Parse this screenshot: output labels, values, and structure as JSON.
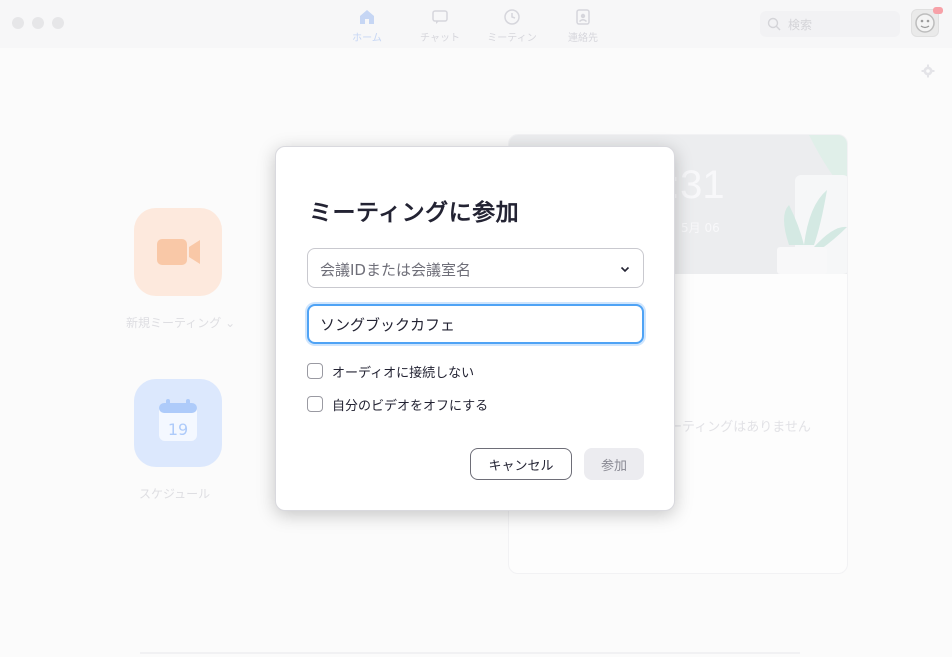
{
  "nav": {
    "home": "ホーム",
    "chat": "チャット",
    "meetings": "ミーティン",
    "contacts": "連絡先"
  },
  "search": {
    "placeholder": "検索"
  },
  "home": {
    "new_meeting_label": "新規ミーティング ⌄",
    "schedule_label": "スケジュール",
    "calendar_day": "19"
  },
  "card": {
    "clock": ":31",
    "date": "5月 06",
    "no_meetings": "ーティングはありません"
  },
  "dialog": {
    "title": "ミーティングに参加",
    "meeting_id_placeholder": "会議IDまたは会議室名",
    "name_value": "ソングブックカフェ",
    "options": [
      {
        "label": "オーディオに接続しない",
        "checked": false
      },
      {
        "label": "自分のビデオをオフにする",
        "checked": false
      }
    ],
    "cancel_label": "キャンセル",
    "join_label": "参加"
  },
  "colors": {
    "accent_focus": "#4fa3f5",
    "new_meeting_tile": "#fde9dd",
    "new_meeting_icon": "#f9c8a7",
    "schedule_tile": "#dce8fd",
    "schedule_icon": "#aecbfa"
  }
}
